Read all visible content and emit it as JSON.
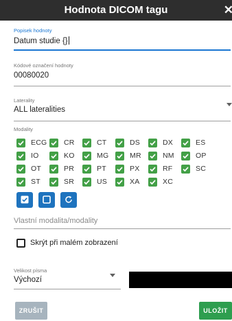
{
  "dialog": {
    "title": "Hodnota DICOM tagu",
    "close_icon": "close-icon"
  },
  "label_field": {
    "label": "Popisek hodnoty",
    "value": "Datum studie {}"
  },
  "code_field": {
    "label": "Kódové označení hodnoty",
    "value": "00080020"
  },
  "laterality": {
    "label": "Laterality",
    "value": "ALL lateralities"
  },
  "modality": {
    "label": "Modality",
    "items": [
      {
        "code": "ECG",
        "checked": true
      },
      {
        "code": "CR",
        "checked": true
      },
      {
        "code": "CT",
        "checked": true
      },
      {
        "code": "DS",
        "checked": true
      },
      {
        "code": "DX",
        "checked": true
      },
      {
        "code": "ES",
        "checked": true
      },
      {
        "code": "IO",
        "checked": true
      },
      {
        "code": "KO",
        "checked": true
      },
      {
        "code": "MG",
        "checked": true
      },
      {
        "code": "MR",
        "checked": true
      },
      {
        "code": "NM",
        "checked": true
      },
      {
        "code": "OP",
        "checked": true
      },
      {
        "code": "OT",
        "checked": true
      },
      {
        "code": "PR",
        "checked": true
      },
      {
        "code": "PT",
        "checked": true
      },
      {
        "code": "PX",
        "checked": true
      },
      {
        "code": "RF",
        "checked": true
      },
      {
        "code": "SC",
        "checked": true
      },
      {
        "code": "ST",
        "checked": true
      },
      {
        "code": "SR",
        "checked": true
      },
      {
        "code": "US",
        "checked": true
      },
      {
        "code": "XA",
        "checked": true
      },
      {
        "code": "XC",
        "checked": true
      }
    ],
    "actions": [
      {
        "name": "select-all-button",
        "icon": "checkbox-checked-icon"
      },
      {
        "name": "deselect-all-button",
        "icon": "checkbox-empty-icon"
      },
      {
        "name": "reset-button",
        "icon": "refresh-icon"
      }
    ]
  },
  "custom_modality": {
    "placeholder": "Vlastní modalita/modality"
  },
  "hide_small": {
    "label": "Skrýt při malém zobrazení",
    "checked": false
  },
  "font_size": {
    "label": "Velikost písma",
    "value": "Výchozí"
  },
  "buttons": {
    "cancel": "ZRUŠIT",
    "save": "ULOŽIT"
  },
  "colors": {
    "titlebar": "#2e2e2e",
    "accent": "#1976d2",
    "checkbox": "#43a047",
    "action_button": "#1e73be",
    "save": "#2e9e4f",
    "cancel": "#a7b4be"
  }
}
